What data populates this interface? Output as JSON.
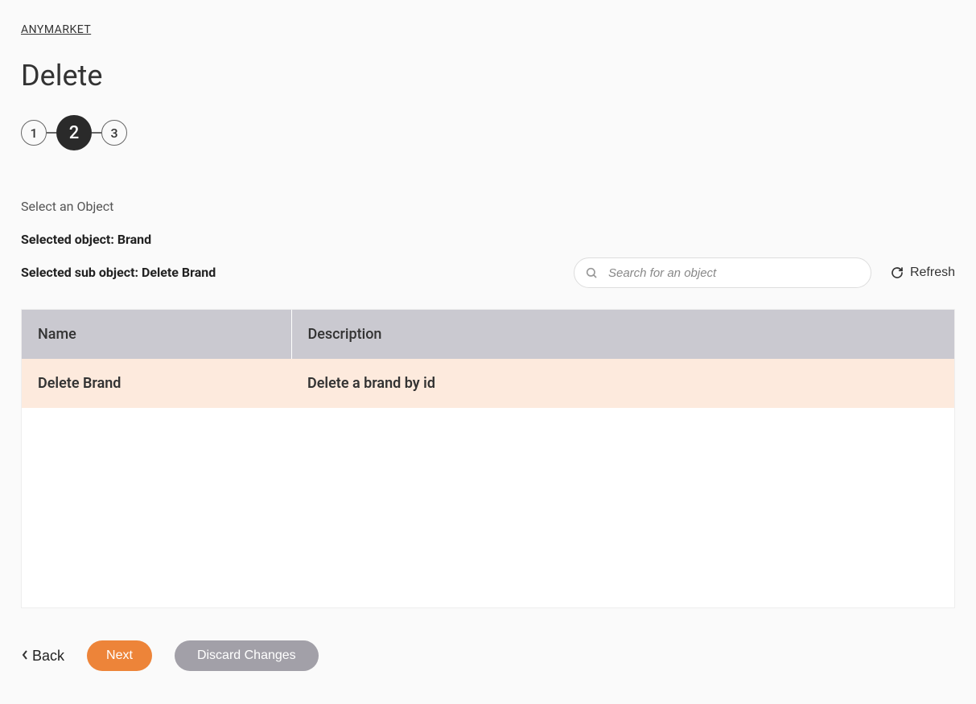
{
  "breadcrumb": "ANYMARKET",
  "page_title": "Delete",
  "stepper": {
    "step1": "1",
    "step2": "2",
    "step3": "3"
  },
  "labels": {
    "select_object": "Select an Object",
    "selected_object": "Selected object: Brand",
    "selected_sub_object": "Selected sub object: Delete Brand"
  },
  "search": {
    "placeholder": "Search for an object"
  },
  "refresh_label": "Refresh",
  "table": {
    "headers": {
      "name": "Name",
      "description": "Description"
    },
    "rows": [
      {
        "name": "Delete Brand",
        "description": "Delete a brand by id"
      }
    ]
  },
  "footer": {
    "back": "Back",
    "next": "Next",
    "discard": "Discard Changes"
  }
}
